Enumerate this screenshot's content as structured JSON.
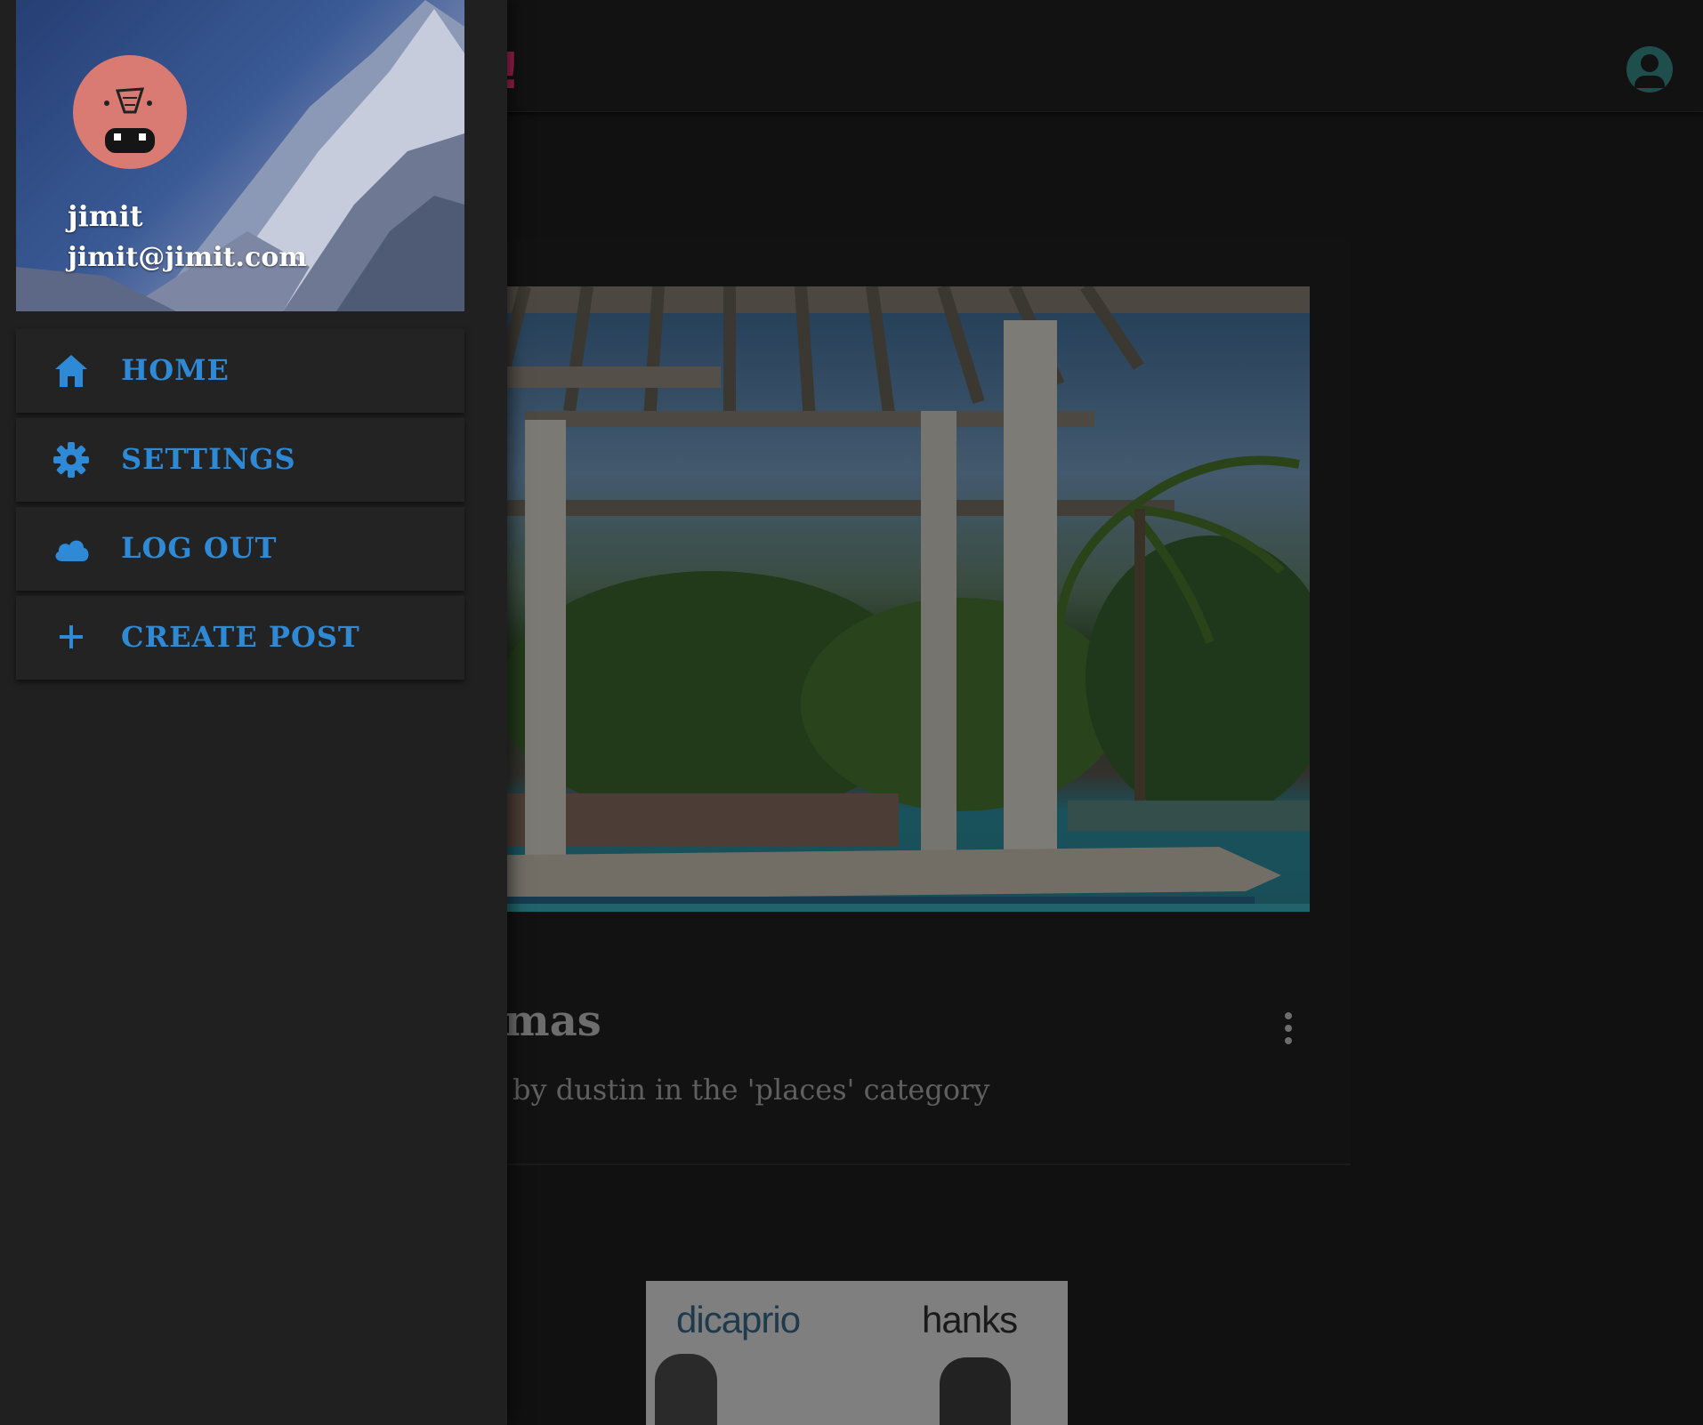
{
  "drawer": {
    "user": {
      "name": "jimit",
      "email": "jimit@jimit.com"
    },
    "items": [
      {
        "label": "HOME",
        "icon": "home-icon"
      },
      {
        "label": "SETTINGS",
        "icon": "gear-icon"
      },
      {
        "label": "LOG OUT",
        "icon": "cloud-icon"
      },
      {
        "label": "CREATE POST",
        "icon": "plus-icon"
      }
    ]
  },
  "post": {
    "title_visible": "homas",
    "meta": "by dustin in the 'places' category"
  },
  "thumbnail": {
    "left_text": "dicaprio",
    "right_text": "hanks"
  },
  "colors": {
    "accent": "#2e8ad6",
    "drawer_bg": "#202020",
    "app_bg": "#111111",
    "avatar_bg": "#d97a73"
  }
}
